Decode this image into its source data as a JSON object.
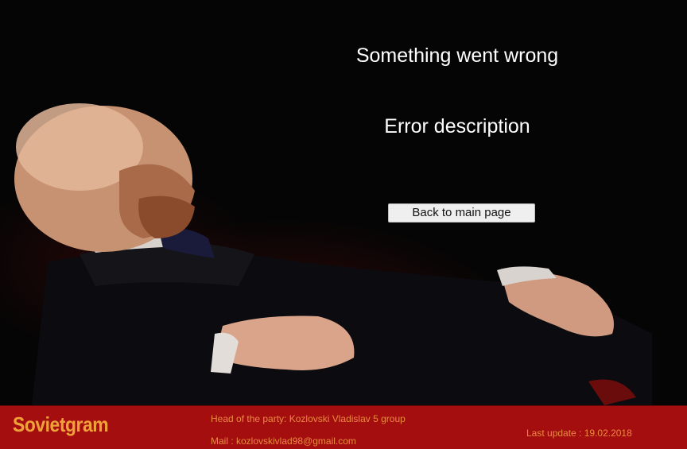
{
  "error": {
    "title": "Something went wrong",
    "description": "Error description",
    "back_button_label": "Back to main page"
  },
  "background": {
    "image": "figure-in-dark-suit-lying-on-red-fabric"
  },
  "footer": {
    "brand": "Sovietgram",
    "head_of_party": "Head of the party: Kozlovski Vladislav 5 group",
    "mail": "Mail : kozlovskivlad98@gmail.com",
    "last_update": "Last update : 19.02.2018",
    "colors": {
      "background": "#a50e0e",
      "brand": "#f0a23a",
      "text": "#e88a40"
    }
  }
}
